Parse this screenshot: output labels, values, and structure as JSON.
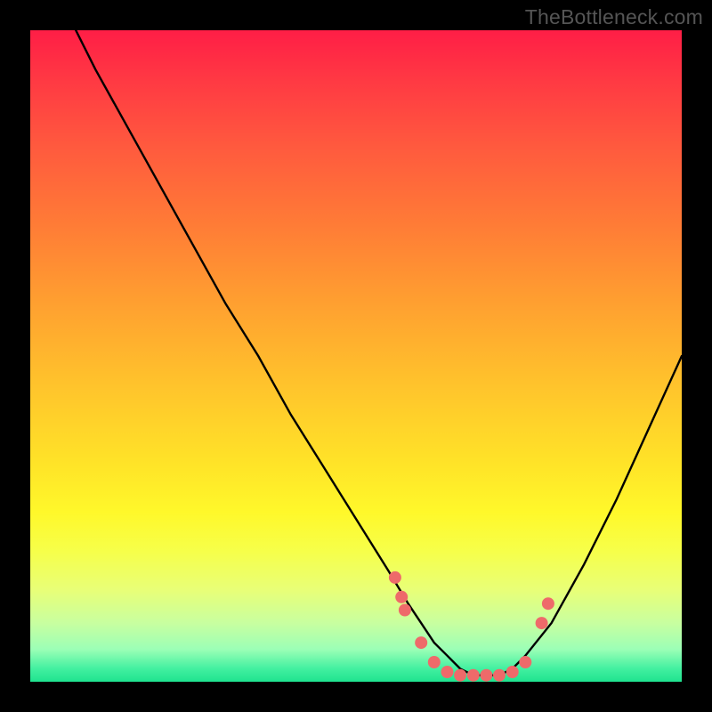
{
  "watermark": "TheBottleneck.com",
  "colors": {
    "background": "#000000",
    "gradient_top": "#ff1e46",
    "gradient_mid": "#ffe228",
    "gradient_bottom": "#1fe38f",
    "curve_stroke": "#000000",
    "dot_fill": "#ee6a6a"
  },
  "chart_data": {
    "type": "line",
    "title": "",
    "xlabel": "",
    "ylabel": "",
    "xlim": [
      0,
      100
    ],
    "ylim": [
      0,
      100
    ],
    "series": [
      {
        "name": "bottleneck-curve",
        "x": [
          7,
          10,
          15,
          20,
          25,
          30,
          35,
          40,
          45,
          50,
          55,
          58,
          60,
          62,
          64,
          66,
          68,
          70,
          72,
          74,
          76,
          80,
          85,
          90,
          95,
          100
        ],
        "y": [
          100,
          94,
          85,
          76,
          67,
          58,
          50,
          41,
          33,
          25,
          17,
          12,
          9,
          6,
          4,
          2,
          1,
          1,
          1,
          2,
          4,
          9,
          18,
          28,
          39,
          50
        ]
      }
    ],
    "highlight_points": {
      "name": "optimal-region-dots",
      "x": [
        56,
        57,
        57.5,
        60,
        62,
        64,
        66,
        68,
        70,
        72,
        74,
        76,
        78.5,
        79.5
      ],
      "y": [
        16,
        13,
        11,
        6,
        3,
        1.5,
        1,
        1,
        1,
        1,
        1.5,
        3,
        9,
        12
      ]
    }
  }
}
